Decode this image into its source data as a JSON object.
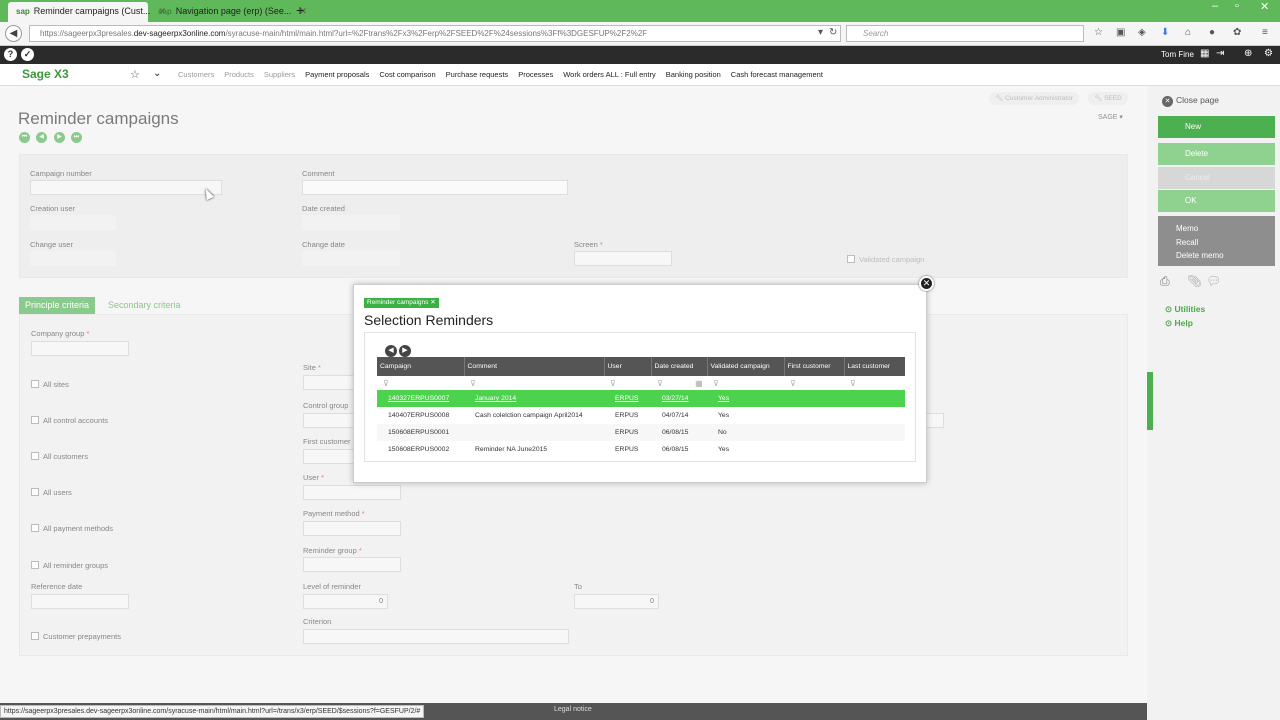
{
  "browser": {
    "tabs": [
      {
        "favicon": "sap",
        "label": "Reminder campaigns (Cust..."
      },
      {
        "favicon": "sap",
        "label": "Navigation page (erp) (See..."
      }
    ],
    "url_prefix": "https://sageerpx3presales.",
    "url_host": "dev-sageerpx3online.com",
    "url_path": "/syracuse-main/html/main.html?url=%2Ftrans%2Fx3%2Ferp%2FSEED%2F%24sessions%3Ff%3DGESFUP%2F2%2F",
    "search_placeholder": "Search"
  },
  "sagebar": {
    "user_name": "Tom Fine"
  },
  "app": {
    "logo": "Sage X3",
    "menu": [
      "Customers",
      "Products",
      "Suppliers",
      "Payment proposals",
      "Cost comparison",
      "Purchase requests",
      "Processes",
      "Work orders ALL : Full entry",
      "Banking position",
      "Cash forecast management"
    ]
  },
  "page": {
    "title": "Reminder campaigns",
    "role_badge": "Customer Administrator",
    "folder_badge": "SEED",
    "sage_dropdown": "SAGE",
    "header_fields": {
      "campaign_number": "Campaign number",
      "comment": "Comment",
      "creation_user": "Creation user",
      "date_created": "Date created",
      "change_user": "Change user",
      "change_date": "Change date",
      "screen": "Screen",
      "validated_campaign": "Validated campaign"
    },
    "tabs": [
      "Principle criteria",
      "Secondary criteria"
    ],
    "criteria": {
      "company_group": "Company group",
      "site": "Site",
      "control_group": "Control group",
      "first_customer": "First customer",
      "user": "User",
      "payment_method": "Payment method",
      "reminder_group": "Reminder group",
      "reference_date": "Reference date",
      "level_of_reminder": "Level of reminder",
      "level_value": "0",
      "to": "To",
      "to_value": "0",
      "criterion": "Criterion",
      "checkboxes": [
        "All sites",
        "All control accounts",
        "All customers",
        "All users",
        "All payment methods",
        "All reminder groups"
      ],
      "customer_prepayments": "Customer prepayments"
    }
  },
  "dialog": {
    "tag": "Reminder campaigns",
    "title": "Selection Reminders",
    "columns": [
      "Campaign",
      "Comment",
      "User",
      "Date created",
      "Validated campaign",
      "First customer",
      "Last customer"
    ],
    "rows": [
      {
        "campaign": "140327ERPUS0007",
        "comment": "January 2014",
        "user": "ERPUS",
        "date": "03/27/14",
        "validated": "Yes",
        "first": "",
        "last": ""
      },
      {
        "campaign": "140407ERPUS0008",
        "comment": "Cash colelction campaign April2014",
        "user": "ERPUS",
        "date": "04/07/14",
        "validated": "Yes",
        "first": "",
        "last": ""
      },
      {
        "campaign": "150608ERPUS0001",
        "comment": "",
        "user": "ERPUS",
        "date": "06/08/15",
        "validated": "No",
        "first": "",
        "last": ""
      },
      {
        "campaign": "150608ERPUS0002",
        "comment": "Reminder NA June2015",
        "user": "ERPUS",
        "date": "06/08/15",
        "validated": "Yes",
        "first": "",
        "last": ""
      }
    ]
  },
  "right_panel": {
    "close_page": "Close page",
    "buttons": [
      "New",
      "Delete",
      "Cancel",
      "OK"
    ],
    "memo": [
      "Memo",
      "Recall",
      "Delete memo"
    ],
    "utilities": "Utilities",
    "help": "Help"
  },
  "status": {
    "url": "https://sageerpx3presales.dev-sageerpx3online.com/syracuse-main/html/main.html?url=/trans/x3/erp/SEED/$sessions?f=GESFUP/2/#",
    "legal": "Legal notice"
  },
  "colors": {
    "brand_green": "#3cb043",
    "selected_row": "#4cd24c",
    "header_dark": "#555555"
  }
}
